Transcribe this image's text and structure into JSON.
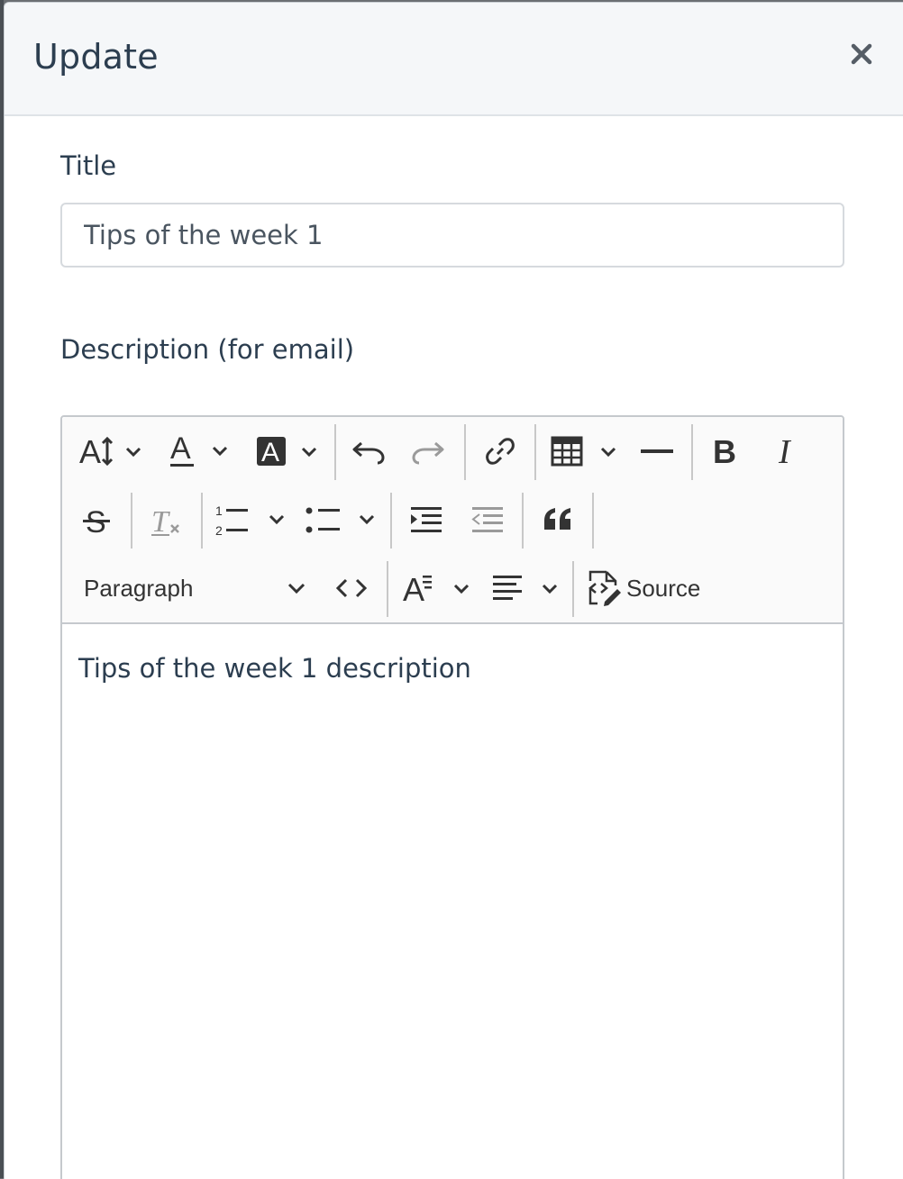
{
  "dialog": {
    "title": "Update",
    "close_label": "×"
  },
  "form": {
    "title_label": "Title",
    "title_value": "Tips of the week 1",
    "description_label": "Description (for email)"
  },
  "editor": {
    "heading_value": "Paragraph",
    "source_label": "Source",
    "content": "Tips of the week 1 description",
    "toolbar_icons": [
      "font-size-icon",
      "font-color-icon",
      "background-color-icon",
      "undo-icon",
      "redo-icon",
      "link-icon",
      "table-icon",
      "horizontal-line-icon",
      "bold-icon",
      "italic-icon",
      "strikethrough-icon",
      "remove-format-icon",
      "numbered-list-icon",
      "bulleted-list-icon",
      "indent-icon",
      "outdent-icon",
      "block-quote-icon",
      "code-icon",
      "text-style-icon",
      "alignment-icon",
      "source-icon"
    ]
  },
  "colors": {
    "text": "#2c3e50",
    "header_bg": "#f5f7f9",
    "toolbar_bg": "#fafafa",
    "disabled_icon": "#9a9a9a"
  }
}
